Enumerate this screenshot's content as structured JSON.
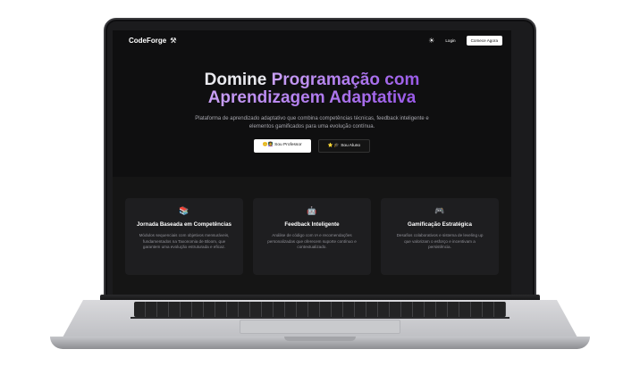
{
  "brand": {
    "name": "CodeForge",
    "logo_icon": "anvil-icon"
  },
  "nav": {
    "theme_icon": "sun-icon",
    "login": "Login",
    "cta": "Comece Agora"
  },
  "hero": {
    "title_part1": "Domine ",
    "title_part2": "Programação com",
    "title_part3": "Aprendizagem Adaptativa",
    "subtitle": "Plataforma de aprendizado adaptativo que combina competências técnicas, feedback inteligente e elementos gamificados para uma evolução contínua.",
    "button_teacher": "😊👩‍🏫 Sou Professor",
    "button_student": "⭐ 🎓 Sou Aluno"
  },
  "features": [
    {
      "icon": "books-icon",
      "glyph": "📚",
      "title": "Jornada Baseada em Competências",
      "text": "Módulos sequenciais com objetivos mensuráveis, fundamentados na Taxonomia de Bloom, que garantem uma evolução estruturada e eficaz."
    },
    {
      "icon": "robot-icon",
      "glyph": "🤖",
      "title": "Feedback Inteligente",
      "text": "Análise de código com IA e recomendações personalizadas que oferecem suporte contínuo e contextualizado."
    },
    {
      "icon": "gamepad-icon",
      "glyph": "🎮",
      "title": "Gamificação Estratégica",
      "text": "Desafios colaborativos e sistema de leveling up que valorizam o esforço e incentivam a persistência."
    }
  ],
  "colors": {
    "accent_start": "#c9a0f5",
    "accent_end": "#9a5ae8",
    "background": "#0f0f10"
  }
}
